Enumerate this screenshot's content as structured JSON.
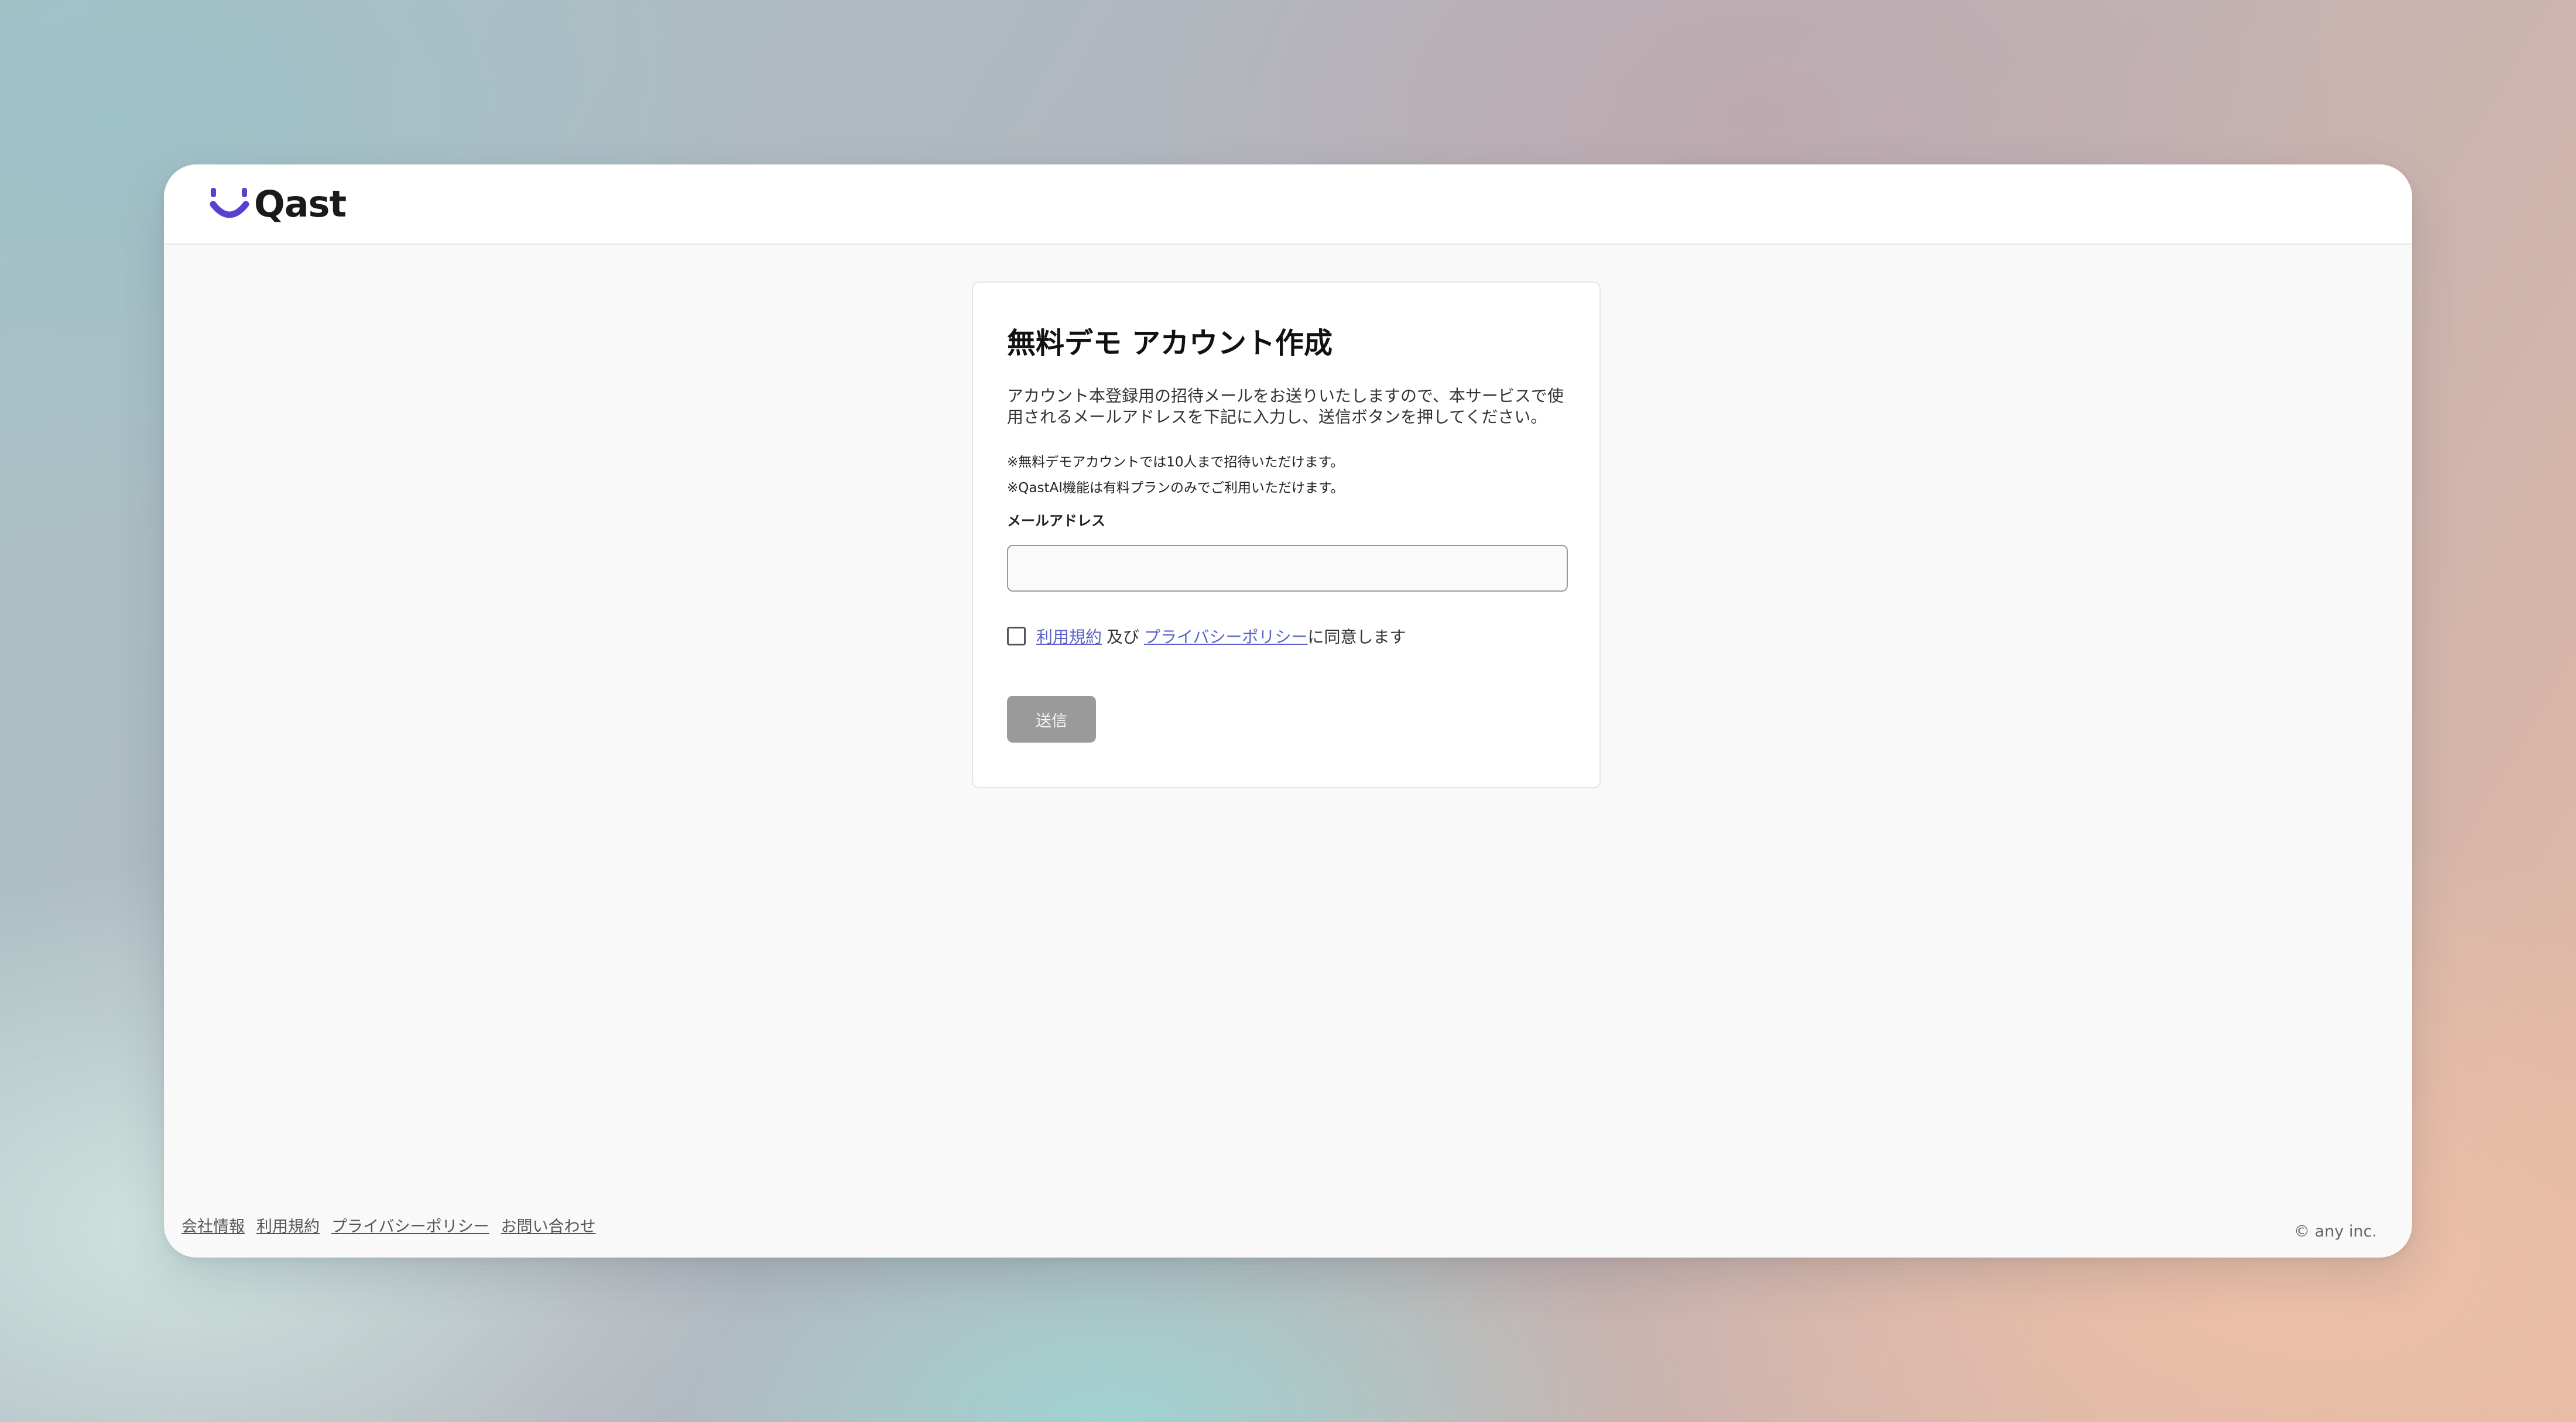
{
  "header": {
    "logo_text": "Qast",
    "logo_color": "#5b3fd0"
  },
  "form": {
    "title": "無料デモ アカウント作成",
    "lead": "アカウント本登録用の招待メールをお送りいたしますので、本サービスで使用されるメールアドレスを下記に入力し、送信ボタンを押してください。",
    "note1": "※無料デモアカウントでは10人まで招待いただけます。",
    "note2": "※QastAI機能は有料プランのみでご利用いただけます。",
    "email_label": "メールアドレス",
    "email_value": "",
    "agree": {
      "checked": false,
      "terms_link": "利用規約",
      "conjunction": "及び",
      "privacy_link": "プライバシーポリシー",
      "suffix": "に同意します"
    },
    "submit_label": "送信"
  },
  "footer": {
    "links": [
      "会社情報",
      "利用規約",
      "プライバシーポリシー",
      "お問い合わせ"
    ],
    "copyright": "© any inc."
  }
}
